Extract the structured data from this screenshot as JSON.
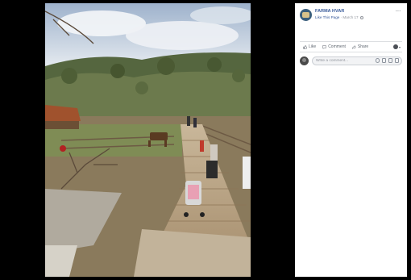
{
  "post": {
    "page_name": "FARMA HVAR",
    "like_link": "Like This Page",
    "separator": " · ",
    "date": "March 17",
    "more_label": "···"
  },
  "actions": {
    "like": "Like",
    "comment": "Comment",
    "share": "Share"
  },
  "comment": {
    "placeholder": "Write a comment..."
  },
  "icons": {
    "like": "thumbs-up-icon",
    "comment": "speech-bubble-icon",
    "share": "share-arrow-icon",
    "privacy": "globe-icon",
    "more": "more-dots-icon",
    "emoji": "emoji-icon",
    "camera": "camera-icon",
    "gif": "gif-icon",
    "sticker": "sticker-icon"
  },
  "colors": {
    "link": "#365899",
    "meta": "#90949c",
    "viewer_bg": "#000000"
  }
}
